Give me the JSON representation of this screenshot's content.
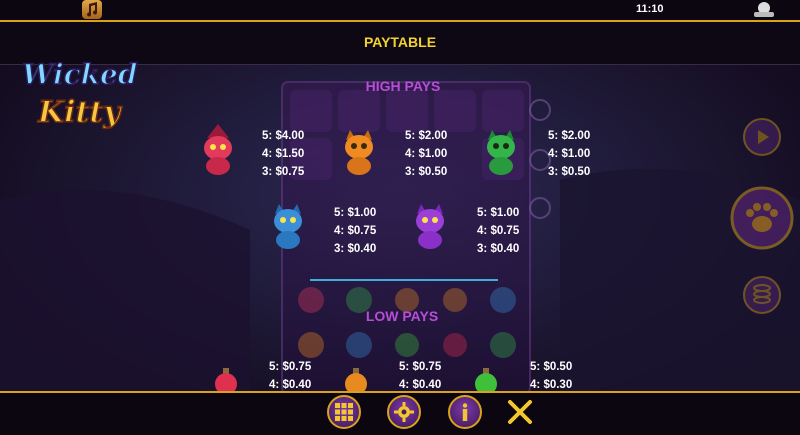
{
  "status_bar": {
    "time": "11:10",
    "music_icon": "music-note-icon"
  },
  "header": {
    "title": "PAYTABLE"
  },
  "logo": {
    "line1": "Wicked",
    "line2": "Kitty"
  },
  "sections": {
    "high": "HIGH PAYS",
    "low": "LOW PAYS"
  },
  "high_pays": [
    {
      "symbol": "red-witch-kitty",
      "color": "#e23a5a",
      "pays": [
        "$4.00",
        "$1.50",
        "$0.75"
      ]
    },
    {
      "symbol": "orange-kitty",
      "color": "#f08a22",
      "pays": [
        "$2.00",
        "$1.00",
        "$0.50"
      ]
    },
    {
      "symbol": "green-kitty",
      "color": "#34b54a",
      "pays": [
        "$2.00",
        "$1.00",
        "$0.50"
      ]
    },
    {
      "symbol": "blue-kitty",
      "color": "#3a8fd8",
      "pays": [
        "$1.00",
        "$0.75",
        "$0.40"
      ]
    },
    {
      "symbol": "purple-kitty",
      "color": "#9b3fd8",
      "pays": [
        "$1.00",
        "$0.75",
        "$0.40"
      ]
    }
  ],
  "low_pays": [
    {
      "symbol": "red-potion",
      "color": "#e03050",
      "pays": [
        "$0.75",
        "$0.40"
      ]
    },
    {
      "symbol": "orange-potion",
      "color": "#e88a20",
      "pays": [
        "$0.75",
        "$0.40"
      ]
    },
    {
      "symbol": "green-potion",
      "color": "#3fbf3a",
      "pays": [
        "$0.50",
        "$0.30"
      ]
    }
  ],
  "counts": {
    "five": "5:",
    "four": "4:",
    "three": "3:"
  },
  "bottom_bar": {
    "buttons": [
      "menu-grid-icon",
      "settings-gear-icon",
      "info-icon",
      "close-icon"
    ]
  },
  "colors": {
    "accent": "#d9a21b",
    "title": "#f2d22e",
    "section": "#b64ed8"
  }
}
